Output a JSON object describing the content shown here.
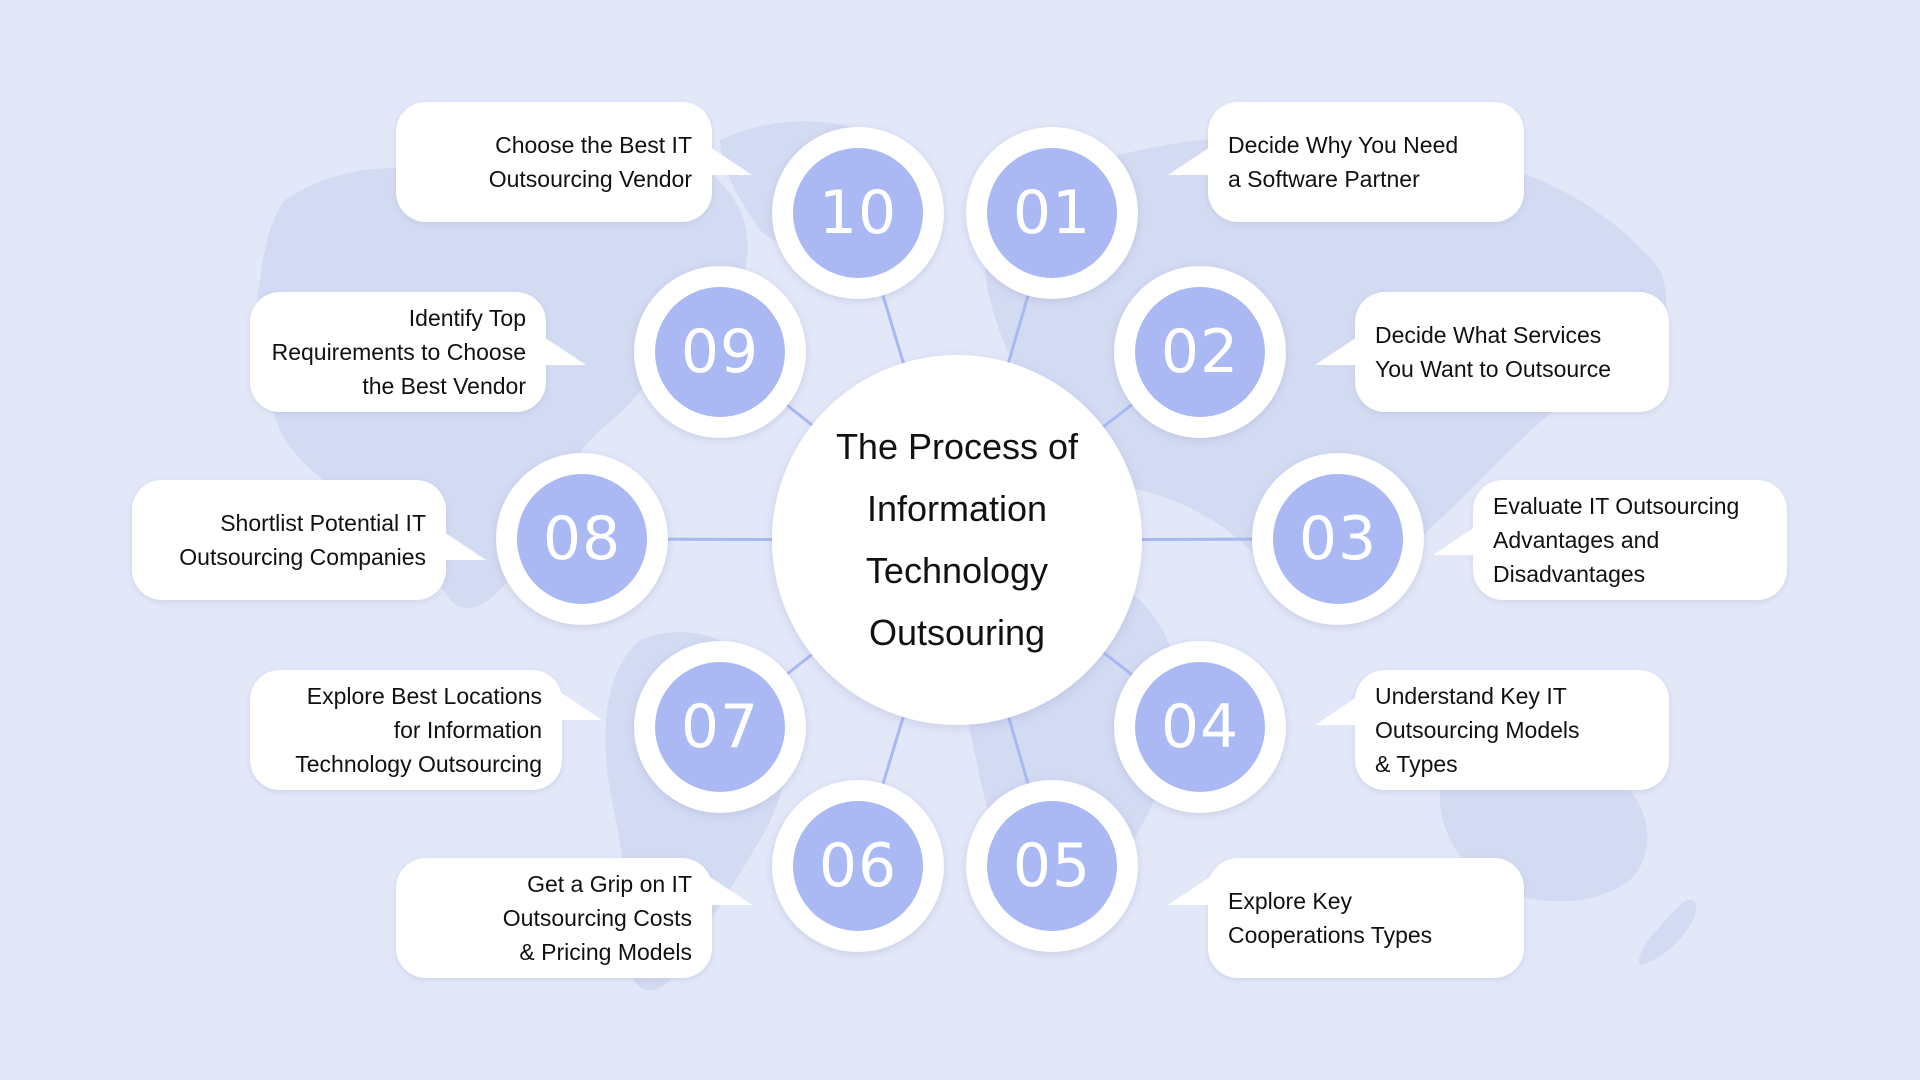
{
  "title_lines": [
    "The Process of",
    "Information",
    "Technology",
    "Outsouring"
  ],
  "colors": {
    "background": "#E2E8F8",
    "map": "#D3DBF3",
    "node_fill": "#AAB9F3",
    "connector": "#A9B8F2",
    "card": "#FFFFFF",
    "text": "#111111"
  },
  "steps": [
    {
      "number": "01",
      "label": "Decide Why You Need\na Software Partner"
    },
    {
      "number": "02",
      "label": "Decide What Services\nYou Want to Outsource"
    },
    {
      "number": "03",
      "label": "Evaluate IT Outsourcing\nAdvantages and\nDisadvantages"
    },
    {
      "number": "04",
      "label": "Understand Key IT\nOutsourcing Models\n& Types"
    },
    {
      "number": "05",
      "label": "Explore Key\nCooperations Types"
    },
    {
      "number": "06",
      "label": "Get a Grip on IT\nOutsourcing Costs\n& Pricing Models"
    },
    {
      "number": "07",
      "label": "Explore Best Locations\nfor Information\nTechnology Outsourcing"
    },
    {
      "number": "08",
      "label": "Shortlist Potential IT\nOutsourcing Companies"
    },
    {
      "number": "09",
      "label": "Identify Top\nRequirements to Choose\nthe Best Vendor"
    },
    {
      "number": "10",
      "label": "Choose the Best IT\nOutsourcing Vendor"
    }
  ]
}
